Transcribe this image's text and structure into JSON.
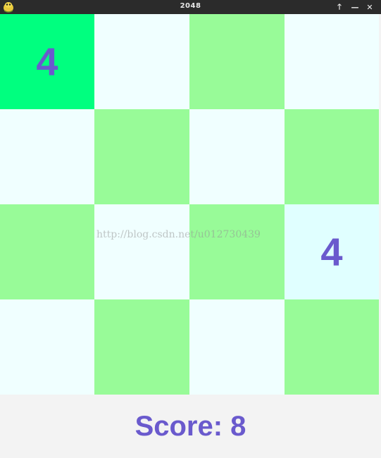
{
  "window": {
    "title": "2048",
    "icon": "python-snake-icon",
    "buttons": [
      {
        "name": "maximize-button",
        "glyph": "🡑"
      },
      {
        "name": "minimize-button",
        "glyph": "—"
      },
      {
        "name": "close-button",
        "glyph": "✕"
      }
    ]
  },
  "board": {
    "size": 4,
    "cells": [
      {
        "value": "4",
        "color": "#00ff7f"
      },
      {
        "value": "",
        "color": "#f0ffff"
      },
      {
        "value": "",
        "color": "#98fb98"
      },
      {
        "value": "",
        "color": "#f0ffff"
      },
      {
        "value": "",
        "color": "#f0ffff"
      },
      {
        "value": "",
        "color": "#98fb98"
      },
      {
        "value": "",
        "color": "#f0ffff"
      },
      {
        "value": "",
        "color": "#98fb98"
      },
      {
        "value": "",
        "color": "#98fb98"
      },
      {
        "value": "",
        "color": "#f0ffff"
      },
      {
        "value": "",
        "color": "#98fb98"
      },
      {
        "value": "4",
        "color": "#e0ffff"
      },
      {
        "value": "",
        "color": "#f0ffff"
      },
      {
        "value": "",
        "color": "#98fb98"
      },
      {
        "value": "",
        "color": "#f0ffff"
      },
      {
        "value": "",
        "color": "#98fb98"
      }
    ],
    "tile_text_color": "#6a5acd"
  },
  "watermark": "http://blog.csdn.net/u012730439",
  "score": {
    "text": "Score: 8",
    "color": "#6a5acd"
  }
}
